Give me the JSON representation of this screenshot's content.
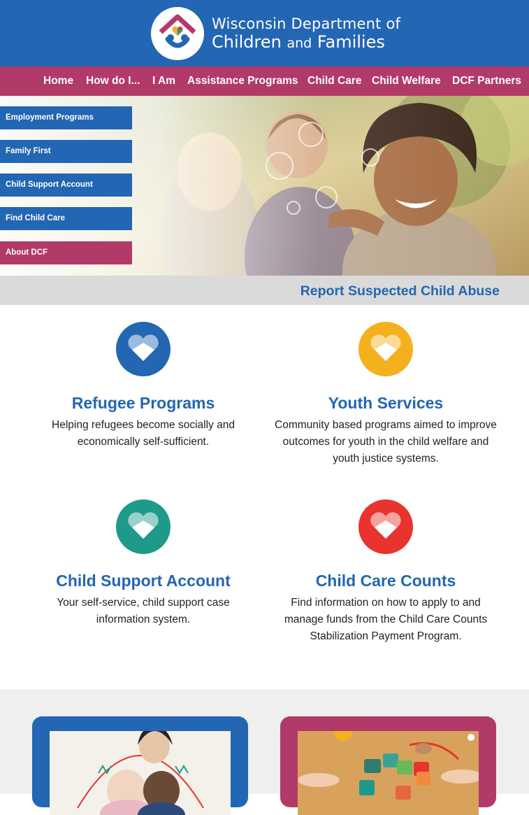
{
  "header": {
    "brand_line1": "Wisconsin Department of",
    "brand_line2_a": "Children",
    "brand_line2_b": "and",
    "brand_line2_c": "Families",
    "logo_icon": "dcf-house-heart-logo"
  },
  "nav": {
    "items": [
      "Home",
      "How do I...",
      "I Am",
      "Assistance Programs",
      "Child Care",
      "Child Welfare",
      "DCF Partners"
    ]
  },
  "sidebar": {
    "buttons": [
      "Employment Programs",
      "Family First",
      "Child Support Account",
      "Find Child Care",
      "About DCF"
    ]
  },
  "report_bar": {
    "link": "Report Suspected Child Abuse"
  },
  "cards": [
    {
      "title": "Refugee Programs",
      "text": "Helping refugees become socially and economically self-sufficient.",
      "color": "#2366b3"
    },
    {
      "title": "Youth Services",
      "text": "Community based programs aimed to improve outcomes for youth in the child welfare and youth justice systems.",
      "color": "#f5b01e"
    },
    {
      "title": "Child Support Account",
      "text": "Your self-service, child support case information system.",
      "color": "#1e9a8a"
    },
    {
      "title": "Child Care Counts",
      "text": "Find information on how to apply to and manage funds from the Child Care Counts Stabilization Payment Program.",
      "color": "#e8332e"
    }
  ],
  "colors": {
    "header_blue": "#2366b3",
    "nav_magenta": "#b23a68",
    "report_bar_gray": "#dadada",
    "promo_blue": "#2366b3",
    "promo_magenta": "#b23a68"
  }
}
